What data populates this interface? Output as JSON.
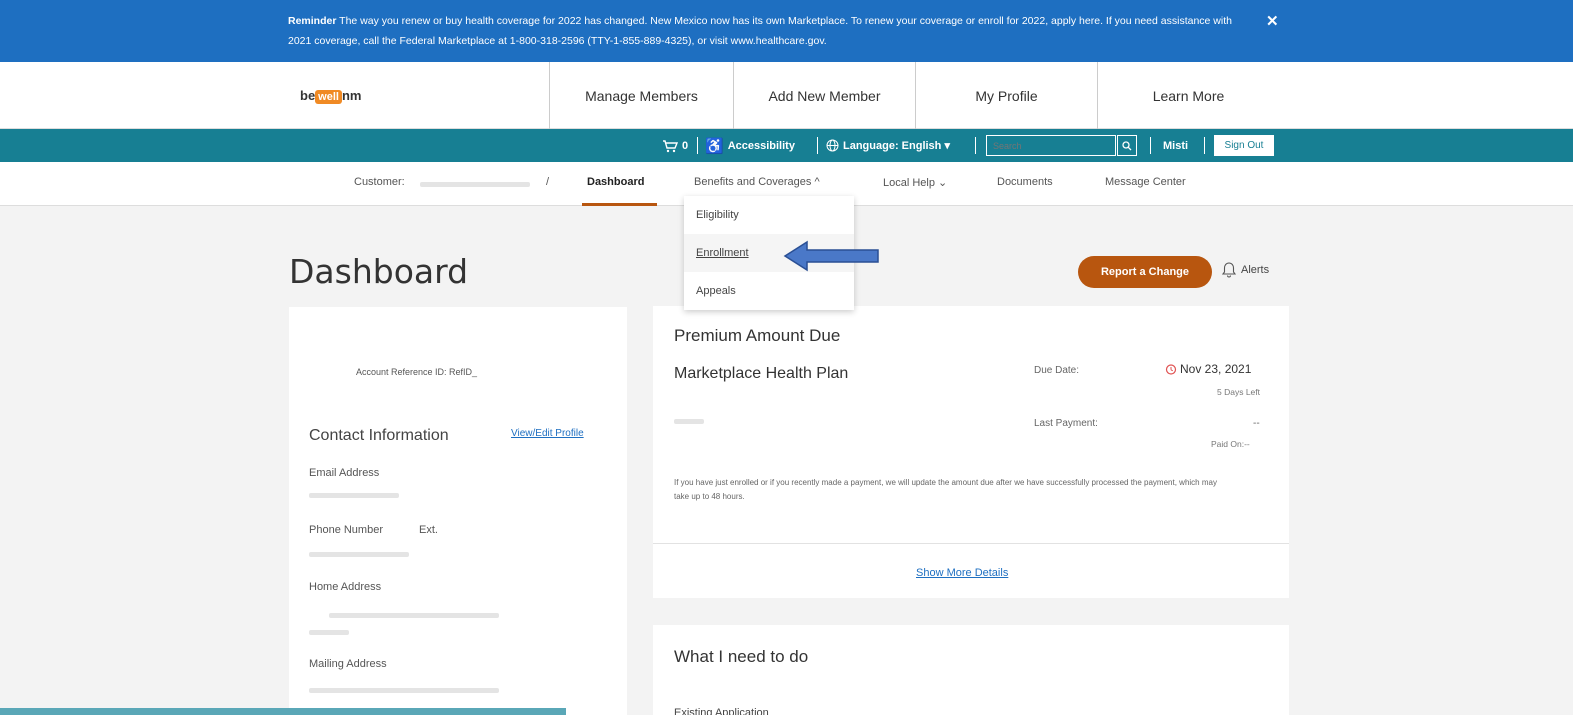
{
  "banner": {
    "label": "Reminder",
    "text": "The way you renew or buy health coverage for 2022 has changed. New Mexico now has its own Marketplace. To renew your coverage or enroll for 2022, apply here. If you need assistance with 2021 coverage, call the Federal Marketplace at 1-800-318-2596 (TTY-1-855-889-4325), or visit www.healthcare.gov.",
    "close": "✕"
  },
  "header": {
    "logo_be": "be",
    "logo_well": "well",
    "logo_nm": "nm",
    "nav": [
      "Manage Members",
      "Add New Member",
      "My Profile",
      "Learn More"
    ]
  },
  "utility": {
    "cart_count": "0",
    "accessibility": "Accessibility",
    "language": "Language: English ▾",
    "search_placeholder": "Search",
    "user": "Misti",
    "signout": "Sign Out"
  },
  "subnav": {
    "customer": "Customer:",
    "slash": "/",
    "items": [
      "Dashboard",
      "Benefits and Coverages ^",
      "Local Help ⌄",
      "Documents",
      "Message Center"
    ]
  },
  "dropdown": {
    "items": [
      "Eligibility",
      "Enrollment",
      "Appeals"
    ]
  },
  "page": {
    "title": "Dashboard",
    "report_button": "Report a Change",
    "alerts": "Alerts"
  },
  "account_card": {
    "ref_id": "Account Reference ID: RefID_",
    "contact_heading": "Contact Information",
    "view_edit": "View/Edit Profile",
    "email_label": "Email Address",
    "phone_label": "Phone Number",
    "ext_label": "Ext.",
    "home_label": "Home Address",
    "mailing_label": "Mailing Address"
  },
  "premium_card": {
    "heading": "Premium Amount Due",
    "plan": "Marketplace Health Plan",
    "due_label": "Due Date:",
    "due_value": "Nov 23, 2021",
    "days_left": "5 Days Left",
    "last_payment_label": "Last Payment:",
    "last_payment_value": "--",
    "paid_on": "Paid On:--",
    "note": "If you have just enrolled or if you recently made a payment, we will update the amount due after we have successfully processed the payment, which may take up to 48 hours.",
    "show_more": "Show More Details"
  },
  "todo_card": {
    "heading": "What I need to do",
    "sub": "Existing Application"
  },
  "colors": {
    "banner": "#1e6fc1",
    "teal": "#177f93",
    "accent": "#b8560f"
  }
}
